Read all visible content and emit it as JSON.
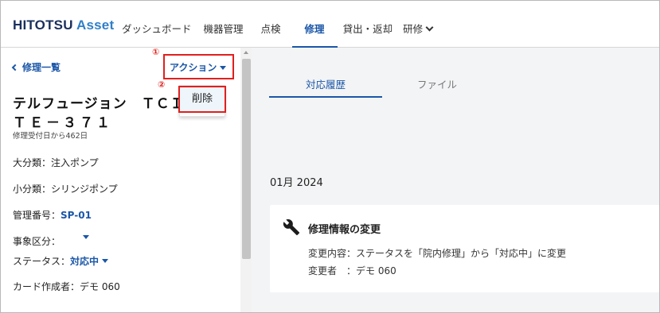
{
  "header": {
    "logo_main": "HITOTSU",
    "logo_accent": "Asset",
    "nav": [
      {
        "label": "ダッシュボード"
      },
      {
        "label": "機器管理"
      },
      {
        "label": "点検"
      },
      {
        "label": "修理"
      },
      {
        "label": "貸出・返却"
      },
      {
        "label": "研修"
      }
    ]
  },
  "left": {
    "back_label": "修理一覧",
    "action_label": "アクション",
    "marker_1": "①",
    "marker_2": "②",
    "delete_label": "削除",
    "title_line1": "テルフュージョン　ＴＣＩホ",
    "title_line2": "ＴＥ－３７１",
    "elapsed": "修理受付日から462日",
    "fields": {
      "major_category": "大分類：注入ポンプ",
      "minor_category": "小分類：シリンジポンプ",
      "mgmt_label": "管理番号：",
      "mgmt_value": "SP-01",
      "event_label": "事象区分：",
      "status_label": "ステータス：",
      "status_value": "対応中",
      "creator": "カード作成者：デモ 060"
    }
  },
  "right": {
    "tabs": [
      {
        "label": "対応履歴",
        "active": true
      },
      {
        "label": "ファイル",
        "active": false
      }
    ],
    "month": "01月 2024",
    "card": {
      "title": "修理情報の変更",
      "line1": "変更内容：ステータスを「院内修理」から「対応中」に変更",
      "line2": "変更者　：デモ 060"
    }
  },
  "colors": {
    "brand_blue": "#1a56a8",
    "highlight_red": "#e0201e",
    "panel_gray": "#f3f4f5"
  },
  "icons": [
    "chevron-left-icon",
    "chevron-down-icon",
    "caret-down-icon",
    "wrench-icon"
  ]
}
